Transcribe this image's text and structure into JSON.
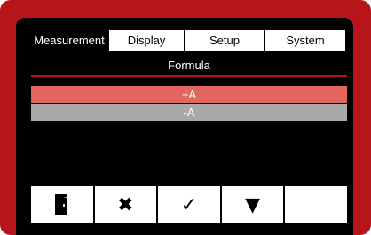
{
  "tabs": [
    {
      "label": "Measurement",
      "active": true
    },
    {
      "label": "Display",
      "active": false
    },
    {
      "label": "Setup",
      "active": false
    },
    {
      "label": "System",
      "active": false
    }
  ],
  "subtitle": "Formula",
  "formula_list": [
    {
      "label": "+A",
      "selected": true
    },
    {
      "label": "-A",
      "selected": false
    }
  ],
  "toolbar": {
    "buttons": [
      {
        "icon": "exit-door-icon"
      },
      {
        "icon": "close-x-icon",
        "glyph": "✖"
      },
      {
        "icon": "checkmark-icon",
        "glyph": "✓"
      },
      {
        "icon": "down-triangle-icon",
        "glyph": "▼"
      },
      {
        "icon": ""
      }
    ]
  },
  "colors": {
    "frame": "#b8151b",
    "screen": "#000000",
    "selected_row": "#e2655f",
    "normal_row": "#a9a9a9"
  }
}
